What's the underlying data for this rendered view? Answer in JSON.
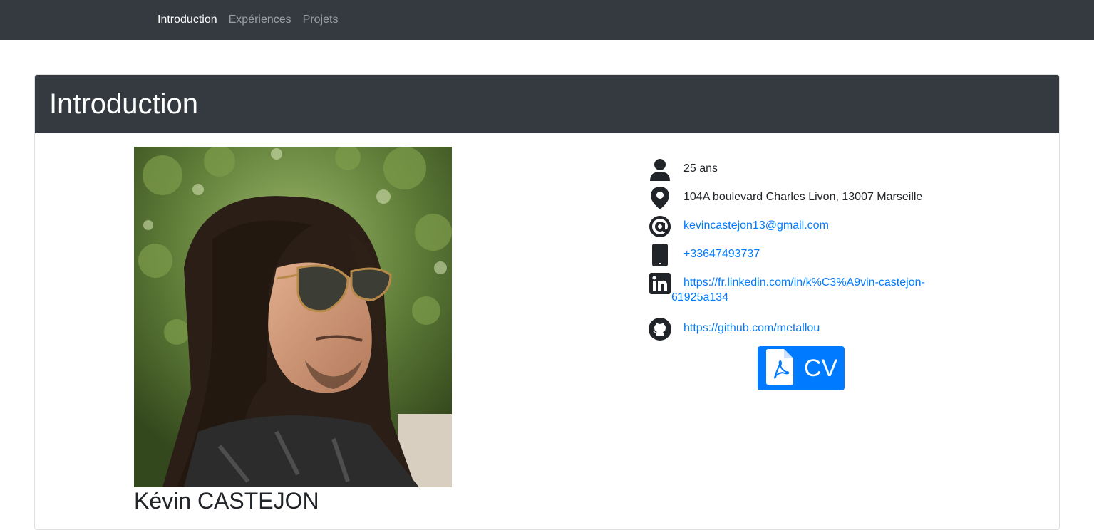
{
  "navbar": {
    "links": [
      {
        "label": "Introduction",
        "active": true
      },
      {
        "label": "Expériences",
        "active": false
      },
      {
        "label": "Projets",
        "active": false
      }
    ]
  },
  "card": {
    "title": "Introduction"
  },
  "profile": {
    "name": "Kévin CASTEJON",
    "photo_description": "portrait photo"
  },
  "info": {
    "age": "25 ans",
    "address": "104A boulevard Charles Livon, 13007 Marseille",
    "email": "kevincastejon13@gmail.com",
    "phone": "+33647493737",
    "linkedin_line1": "https://fr.linkedin.com/in/k%C3%A9vin-castejon-",
    "linkedin_line2": "61925a134",
    "github": "https://github.com/metallou"
  },
  "cv_button": {
    "label": "CV",
    "icon": "pdf-file-icon"
  },
  "colors": {
    "navbar_bg": "#343a40",
    "link": "#007bff",
    "text": "#212529",
    "button_bg": "#007bff"
  },
  "icons": [
    "user-icon",
    "map-pin-icon",
    "at-icon",
    "phone-icon",
    "linkedin-icon",
    "github-icon",
    "pdf-file-icon"
  ]
}
